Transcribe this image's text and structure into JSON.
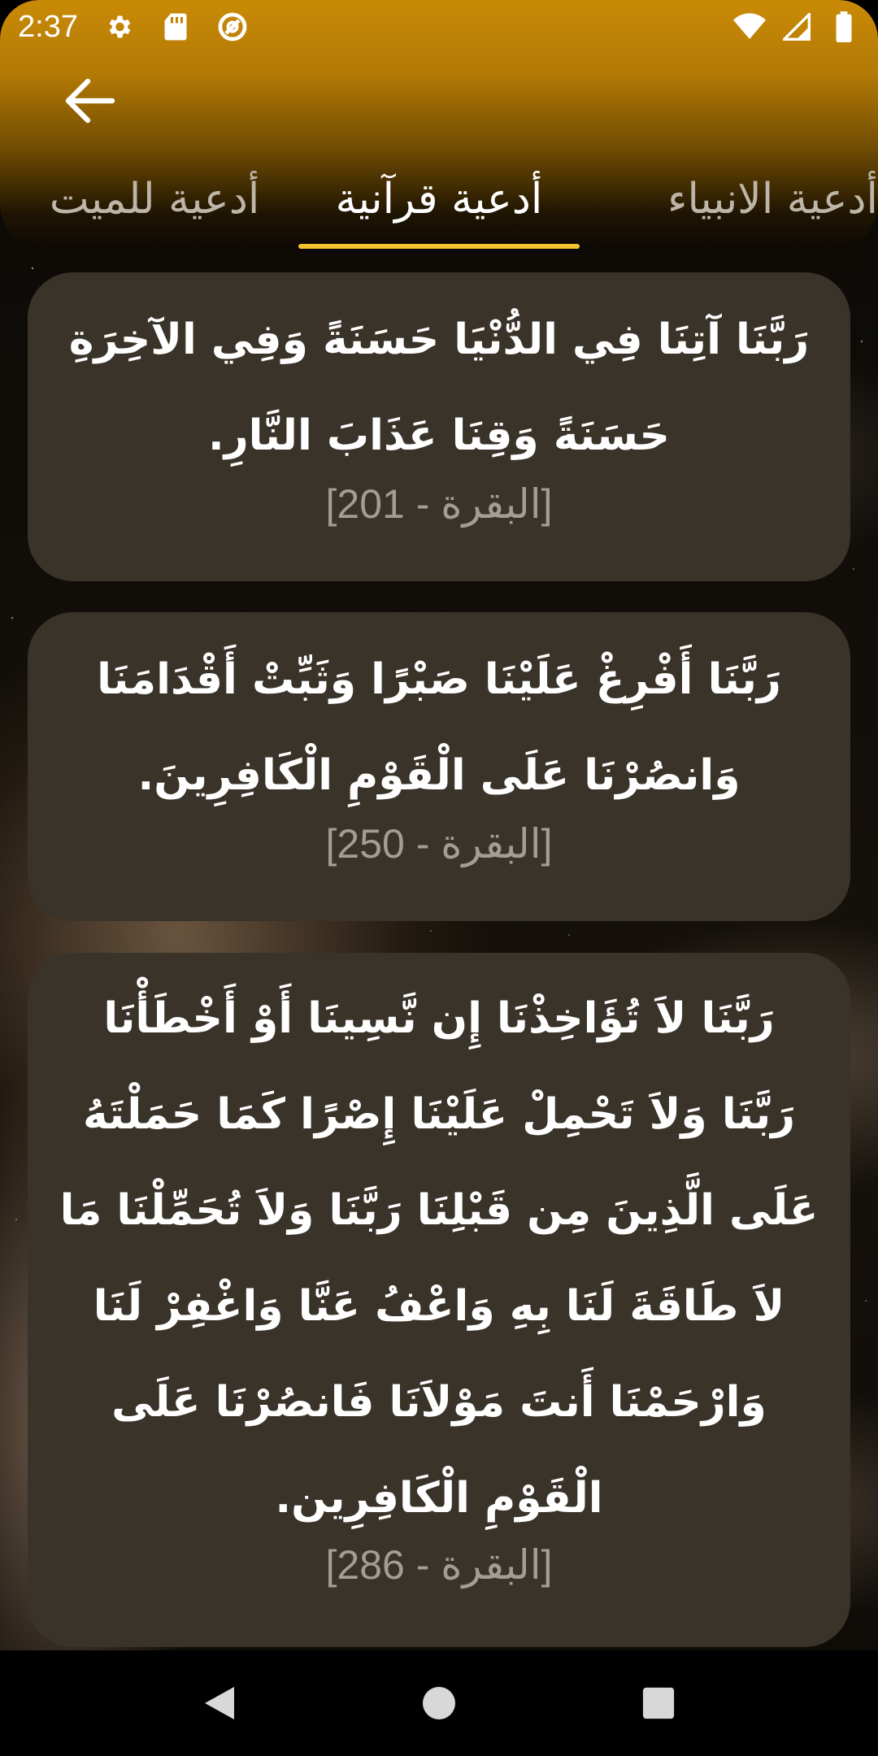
{
  "status_bar": {
    "time": "2:37",
    "left_icons": [
      "gear-icon",
      "sd-card-icon",
      "at-sign-icon"
    ],
    "right_icons": [
      "wifi-icon",
      "signal-icon",
      "battery-icon"
    ]
  },
  "app_bar": {
    "back_icon": "arrow-left-icon",
    "accent_color": "#f3c431"
  },
  "tabs": [
    {
      "label": "أدعية الانبياء",
      "active": false
    },
    {
      "label": "أدعية قرآنية",
      "active": true
    },
    {
      "label": "أدعية للميت",
      "active": false
    }
  ],
  "cards": [
    {
      "lines": [
        "رَبَّنَا آتِنَا فِي الدُّنْيَا حَسَنَةً وَفِي الآخِرَةِ",
        "حَسَنَةً وَقِنَا عَذَابَ النَّارِ."
      ],
      "reference": "[البقرة - 201]"
    },
    {
      "lines": [
        "رَبَّنَا أَفْرِغْ عَلَيْنَا صَبْرًا وَثَبِّتْ أَقْدَامَنَا",
        "وَانصُرْنَا عَلَى الْقَوْمِ الْكَافِرِينَ."
      ],
      "reference": "[البقرة - 250]"
    },
    {
      "lines": [
        "رَبَّنَا لاَ تُؤَاخِذْنَا إِن نَّسِينَا أَوْ أَخْطَأْنَا",
        "رَبَّنَا وَلاَ تَحْمِلْ عَلَيْنَا إِصْرًا كَمَا حَمَلْتَهُ",
        "عَلَى الَّذِينَ مِن قَبْلِنَا رَبَّنَا وَلاَ تُحَمِّلْنَا مَا",
        "لاَ طَاقَةَ لَنَا بِهِ وَاعْفُ عَنَّا وَاغْفِرْ لَنَا",
        "وَارْحَمْنَا أَنتَ مَوْلاَنَا فَانصُرْنَا عَلَى",
        "الْقَوْمِ الْكَافِرِين."
      ],
      "reference": "[البقرة - 286]"
    }
  ],
  "nav_bar": {
    "buttons": [
      "back-triangle-icon",
      "home-circle-icon",
      "recents-square-icon"
    ]
  }
}
